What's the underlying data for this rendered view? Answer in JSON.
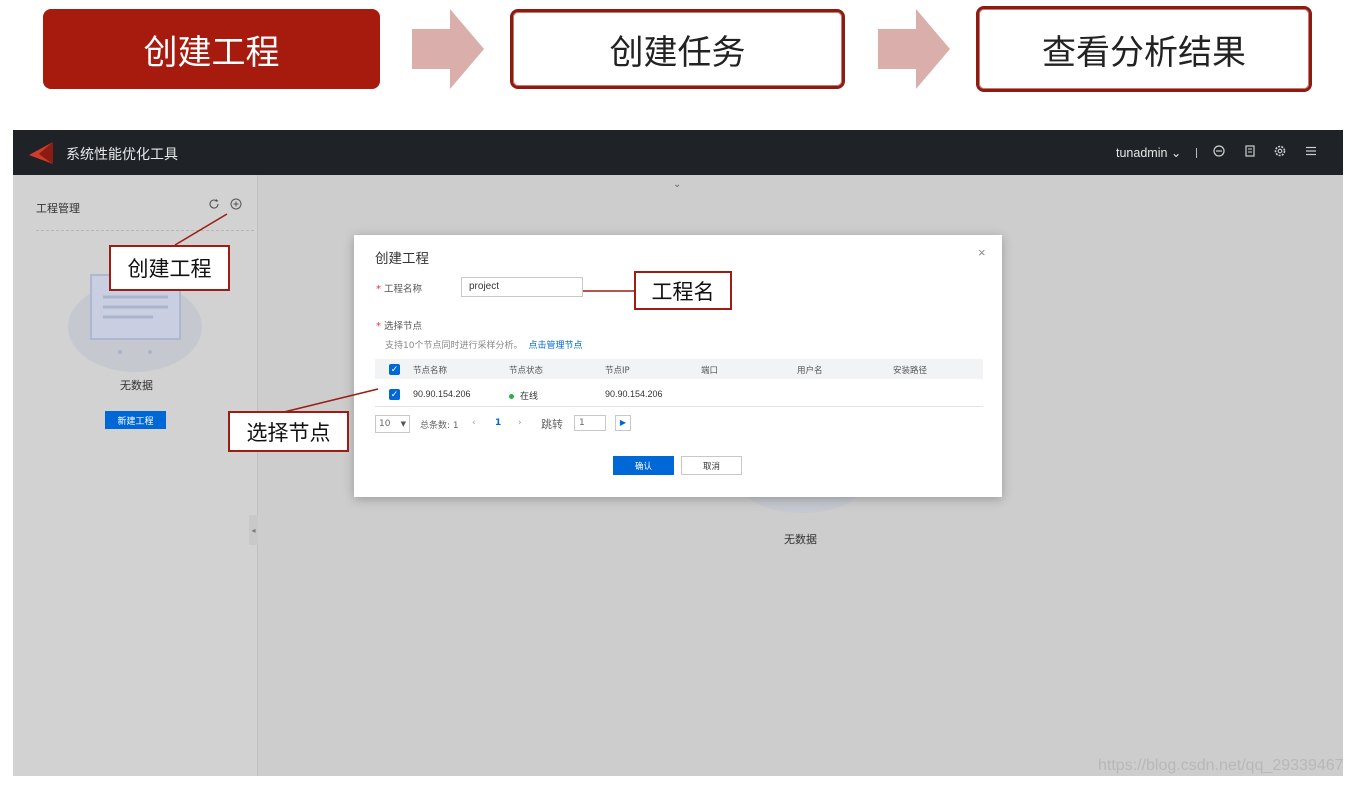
{
  "steps": [
    {
      "label": "创建工程",
      "active": true
    },
    {
      "label": "创建任务",
      "active": false
    },
    {
      "label": "查看分析结果",
      "active": false
    }
  ],
  "app": {
    "title": "系统性能优化工具",
    "user": "tunadmin ⌄",
    "icons": [
      "logout-icon",
      "document-icon",
      "settings-icon",
      "menu-icon"
    ]
  },
  "sidebar": {
    "title": "工程管理",
    "empty_text": "无数据",
    "new_button": "新建工程"
  },
  "main": {
    "empty_text": "无数据"
  },
  "dialog": {
    "title": "创建工程",
    "close": "×",
    "name_label": "工程名称",
    "name_value": "project",
    "nodes_label": "选择节点",
    "hint": "支持10个节点同时进行采样分析。",
    "hint_link": "点击管理节点",
    "table": {
      "headers": [
        "节点名称",
        "节点状态",
        "节点IP",
        "端口",
        "用户名",
        "安装路径"
      ],
      "rows": [
        {
          "name": "90.90.154.206",
          "status": "在线",
          "ip": "90.90.154.206",
          "port": "",
          "user": "",
          "path": ""
        }
      ]
    },
    "pager": {
      "page_size": "10",
      "total": "总条数: 1",
      "prev": "‹",
      "current": "1",
      "next": "›",
      "jump_label": "跳转",
      "jump_value": "1",
      "go": "▶"
    },
    "ok": "确认",
    "cancel": "取消"
  },
  "callouts": {
    "create_project": "创建工程",
    "project_name": "工程名",
    "select_nodes": "选择节点"
  },
  "watermark": "https://blog.csdn.net/qq_29339467",
  "colors": {
    "brand_red": "#a61b0e",
    "primary_blue": "#0067d6",
    "online_green": "#26b145",
    "topbar": "#1f2328"
  }
}
